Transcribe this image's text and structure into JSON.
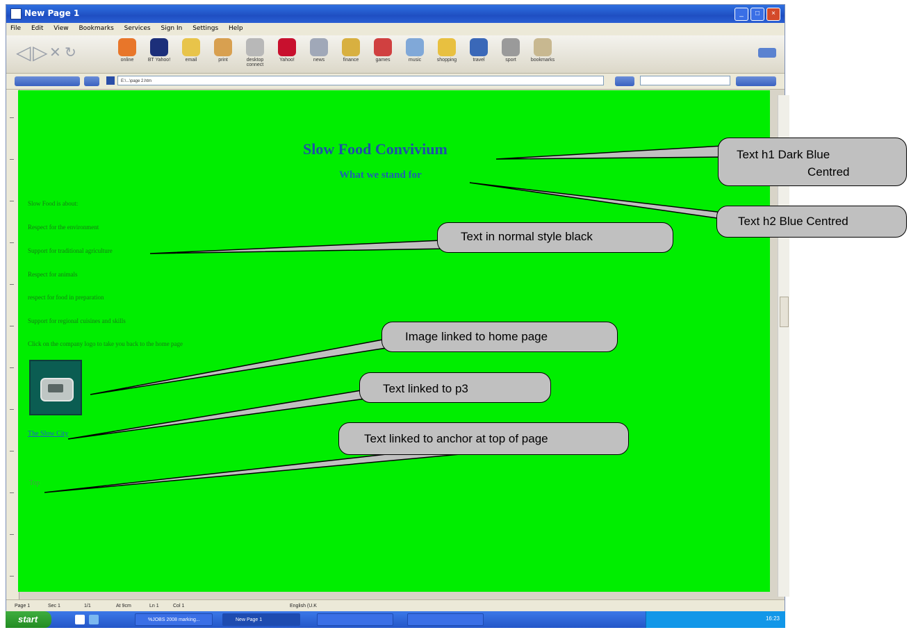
{
  "window": {
    "title": "New Page 1",
    "menu": [
      "File",
      "Edit",
      "View",
      "Bookmarks",
      "Services",
      "Sign In",
      "Settings",
      "Help"
    ],
    "toolbar_buttons": [
      "online",
      "BT Yahoo!",
      "email",
      "print",
      "desktop connect",
      "Yahoo!",
      "news",
      "finance",
      "games",
      "music",
      "shopping",
      "travel",
      "sport",
      "bookmarks"
    ],
    "address": "E:\\...\\page 2.htm"
  },
  "page": {
    "heading1": "Slow Food Convivium",
    "heading2": "What we stand for",
    "paragraphs": [
      "Slow Food is about:",
      "Respect for the environment",
      "Support for traditional agriculture",
      "Respect for animals",
      "respect for food in preparation",
      "Support for regional cuisines and skills",
      "Click on the company logo to take you back to the home page"
    ],
    "link_p3": "The Slow City",
    "link_top": "Top"
  },
  "callouts": {
    "h1_line1": "Text h1 Dark Blue",
    "h1_line2": "Centred",
    "h2": "Text h2 Blue Centred",
    "normal": "Text in normal style black",
    "image": "Image linked to home page",
    "p3": "Text linked to p3",
    "anchor": "Text linked to anchor at top of page"
  },
  "statusbar": {
    "page": "Page 1",
    "sec": "Sec 1",
    "pages": "1/1",
    "at": "At 9cm",
    "ln": "Ln 1",
    "col": "Col 1",
    "lang": "English (U.K"
  },
  "taskbar": {
    "start": "start",
    "tasks": [
      "%JOBS 2008 marking...",
      "New Page 1"
    ],
    "clock": "16:23"
  },
  "colors": {
    "page_background": "#00ee00",
    "heading1": "#1f4fa8",
    "heading2": "#1f5fb0",
    "callout_fill": "#c0c0c0"
  }
}
